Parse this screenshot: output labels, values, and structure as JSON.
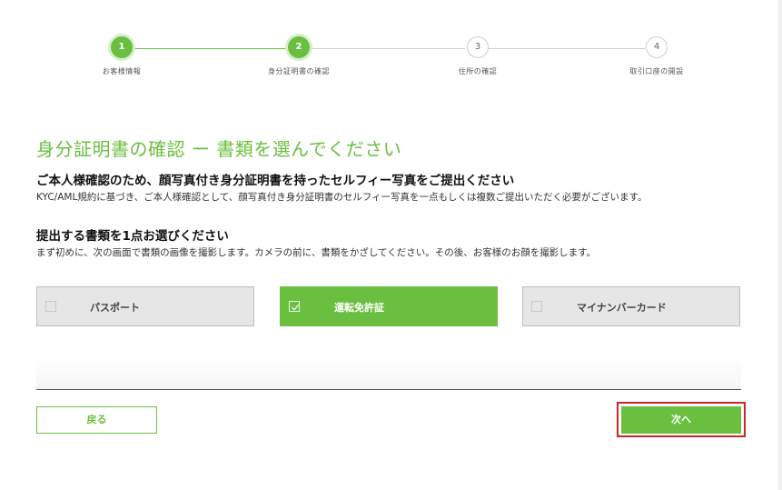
{
  "colors": {
    "accent": "#6abf40",
    "highlight_border": "#c8262f",
    "option_unselected_bg": "#e6e6e6"
  },
  "stepper": {
    "steps": [
      {
        "number": "1",
        "label": "お客様情報",
        "state": "done"
      },
      {
        "number": "2",
        "label": "身分証明書の確認",
        "state": "current"
      },
      {
        "number": "3",
        "label": "住所の確認",
        "state": "todo"
      },
      {
        "number": "4",
        "label": "取引口座の開設",
        "state": "todo"
      }
    ]
  },
  "main": {
    "title": "身分証明書の確認 ー 書類を選んでください",
    "subtitle_1": "ご本人様確認のため、顔写真付き身分証明書を持ったセルフィー写真をご提出ください",
    "description_1": "KYC/AML規約に基づき、ご本人様確認として、顔写真付き身分証明書のセルフィー写真を一点もしくは複数ご提出いただく必要がございます。",
    "subtitle_2": "提出する書類を1点お選びください",
    "description_2": "まず初めに、次の画面で書類の画像を撮影します。カメラの前に、書類をかざしてください。その後、お客様のお顔を撮影します。"
  },
  "document_options": [
    {
      "label": "パスポート",
      "selected": false,
      "icon": "checkbox-icon"
    },
    {
      "label": "運転免許証",
      "selected": true,
      "icon": "checkmark-icon"
    },
    {
      "label": "マイナンバーカード",
      "selected": false,
      "icon": "checkbox-icon"
    }
  ],
  "footer": {
    "back_label": "戻る",
    "next_label": "次へ"
  }
}
